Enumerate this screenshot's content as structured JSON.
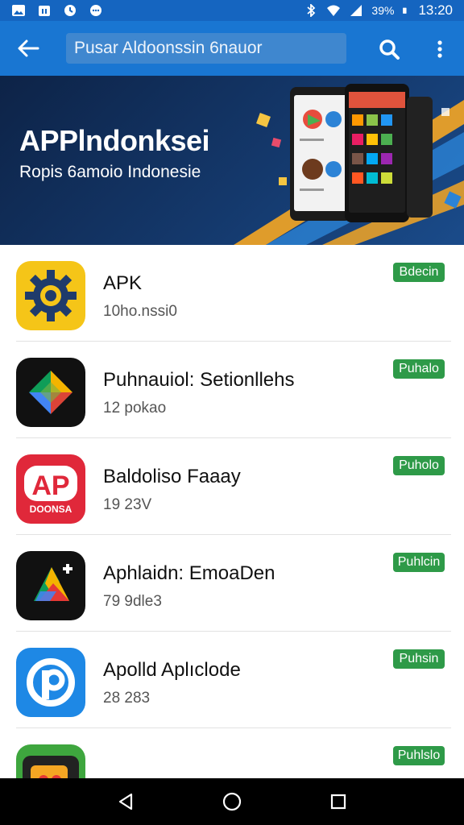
{
  "status_bar": {
    "battery": "39%",
    "time": "13:20"
  },
  "app_bar": {
    "search_text": "Pusar Aldoonssin 6nauor"
  },
  "banner": {
    "title": "APPlndonksei",
    "subtitle": "Ropis 6amoio  Indonesie"
  },
  "apps": [
    {
      "name": "APK",
      "meta": "10ho.nssi0",
      "badge": "Bdecin"
    },
    {
      "name": "Puhnauiol: Setionllehs",
      "meta": "12  pokao",
      "badge": "Puhalo"
    },
    {
      "name": "Baldoliso Faaay",
      "meta": "19 23V",
      "badge": "Puholo"
    },
    {
      "name": "Aphlaidn: EmoaDen",
      "meta": "79 9dle3",
      "badge": "Puhlcin"
    },
    {
      "name": "Apolld Aplıclode",
      "meta": "28 283",
      "badge": "Puhsin"
    },
    {
      "name": "",
      "meta": "",
      "badge": "Puhlslo"
    }
  ],
  "app_icon_text": {
    "ap_letters": "AP",
    "ap_caption": "DOONSA"
  },
  "colors": {
    "primary": "#1976d2",
    "status_bar": "#1565c0",
    "badge": "#2e9a48"
  }
}
